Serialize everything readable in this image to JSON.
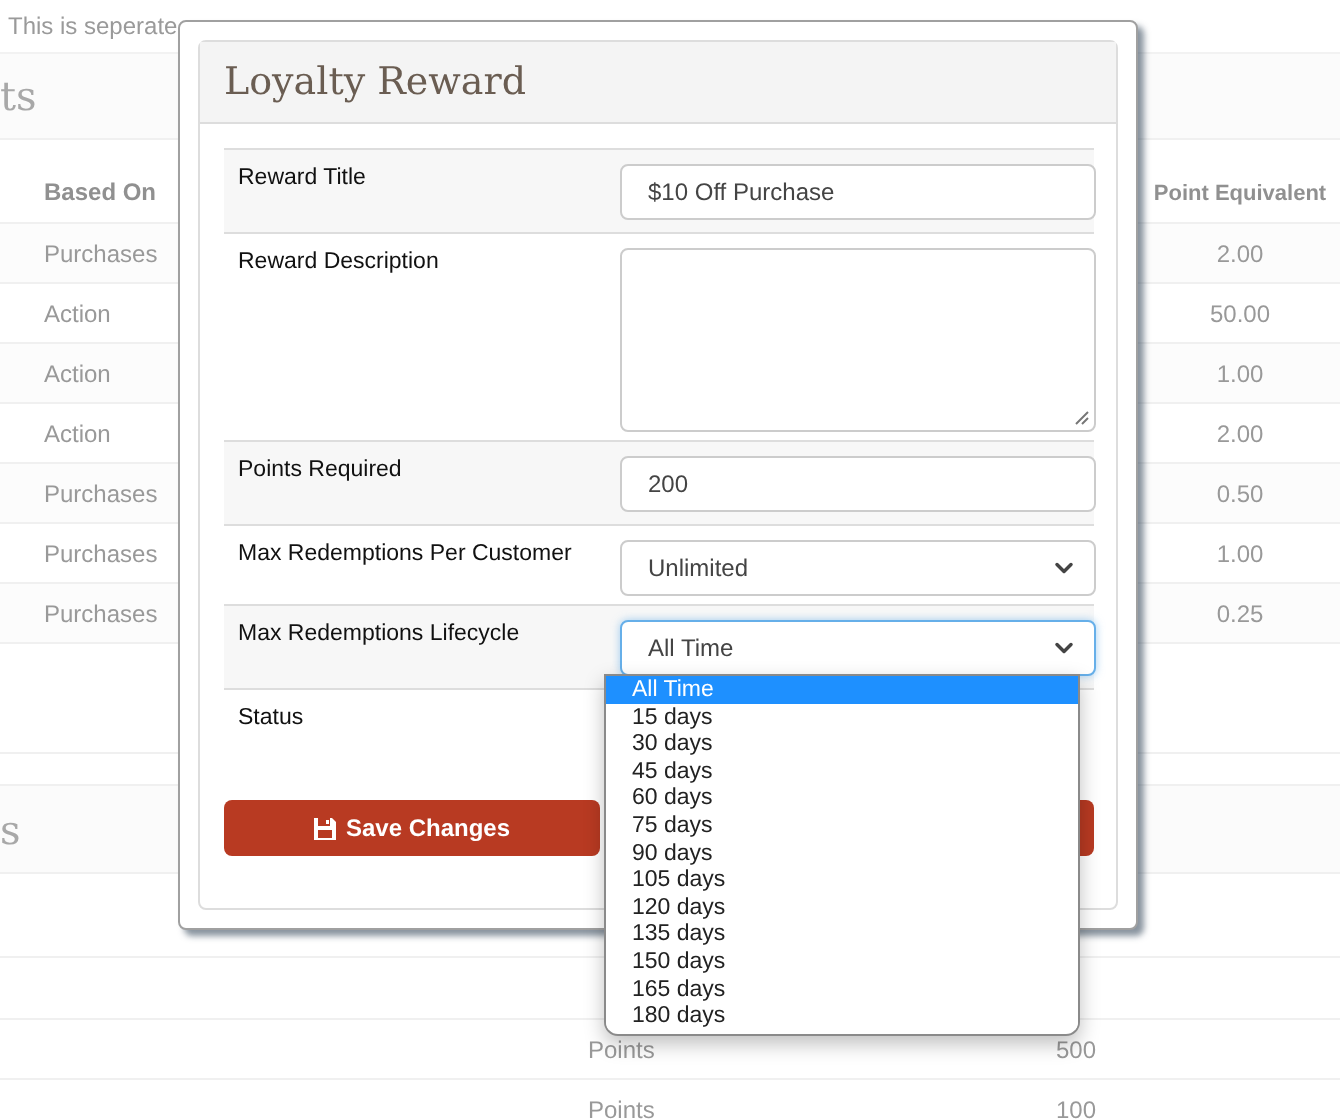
{
  "background": {
    "note": "This is seperate",
    "section_title": "ts",
    "table": {
      "columns": [
        "Based On",
        "Point Equivalent"
      ],
      "rows": [
        {
          "based_on": "Purchases",
          "point_equivalent": "2.00"
        },
        {
          "based_on": "Action",
          "point_equivalent": "50.00"
        },
        {
          "based_on": "Action",
          "point_equivalent": "1.00"
        },
        {
          "based_on": "Action",
          "point_equivalent": "2.00"
        },
        {
          "based_on": "Purchases",
          "point_equivalent": "0.50"
        },
        {
          "based_on": "Purchases",
          "point_equivalent": "1.00"
        },
        {
          "based_on": "Purchases",
          "point_equivalent": "0.25"
        }
      ]
    },
    "section2_title": "s",
    "table2": {
      "rows": [
        {
          "column_1": "Points",
          "column_2": "500"
        },
        {
          "column_1": "Points",
          "column_2": "100"
        }
      ]
    }
  },
  "modal": {
    "title": "Loyalty Reward",
    "fields": [
      {
        "kind": "text",
        "label": "Reward Title",
        "value": "$10 Off Purchase"
      },
      {
        "kind": "textarea",
        "label": "Reward Description"
      },
      {
        "kind": "text",
        "label": "Points Required",
        "value": "200"
      },
      {
        "kind": "select",
        "label": "Max Redemptions Per Customer",
        "value": "Unlimited",
        "focused": false
      },
      {
        "kind": "select",
        "label": "Max Redemptions Lifecycle",
        "value": "All Time",
        "focused": true,
        "expanded": true,
        "options": [
          {
            "label": "All Time",
            "selected": true
          },
          {
            "label": "15 days",
            "selected": false
          },
          {
            "label": "30 days",
            "selected": false
          },
          {
            "label": "45 days",
            "selected": false
          },
          {
            "label": "60 days",
            "selected": false
          },
          {
            "label": "75 days",
            "selected": false
          },
          {
            "label": "90 days",
            "selected": false
          },
          {
            "label": "105 days",
            "selected": false
          },
          {
            "label": "120 days",
            "selected": false
          },
          {
            "label": "135 days",
            "selected": false
          },
          {
            "label": "150 days",
            "selected": false
          },
          {
            "label": "165 days",
            "selected": false
          },
          {
            "label": "180 days",
            "selected": false
          }
        ]
      },
      {
        "kind": "label_only",
        "label": "Status"
      }
    ],
    "buttons": [
      {
        "kind": "save",
        "label": "Save Changes"
      },
      {
        "kind": "danger"
      }
    ]
  }
}
